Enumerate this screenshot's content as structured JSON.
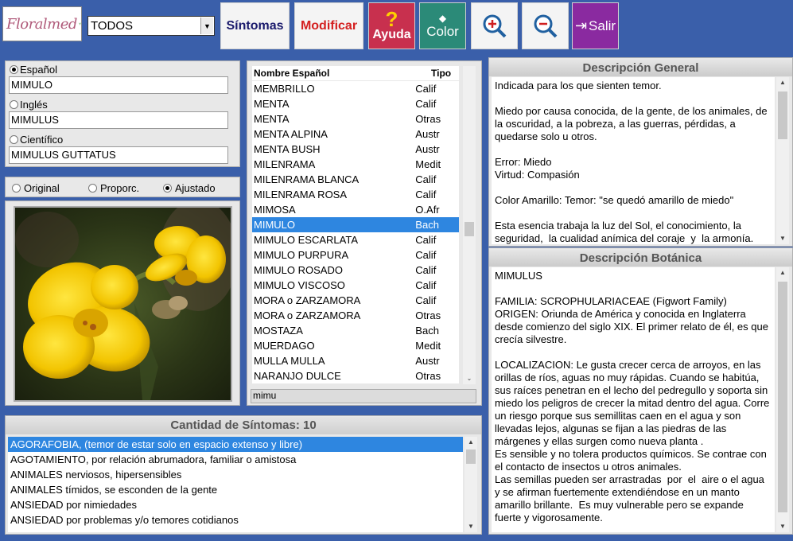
{
  "toolbar": {
    "logo_text": "Floralmed",
    "filter_value": "TODOS",
    "sintomas_label": "Síntomas",
    "modificar_label": "Modificar",
    "ayuda_label": "Ayuda",
    "color_label": "Color",
    "zoom_in_icon": "zoom-in-icon",
    "zoom_out_icon": "zoom-out-icon",
    "salir_label": "Salir"
  },
  "languages": {
    "espanol_label": "Español",
    "espanol_value": "MIMULO",
    "ingles_label": "Inglés",
    "ingles_value": "MIMULUS",
    "cientifico_label": "Científico",
    "cientifico_value": "MIMULUS GUTTATUS",
    "selected": "Español"
  },
  "image_mode": {
    "original_label": "Original",
    "proporc_label": "Proporc.",
    "ajustado_label": "Ajustado",
    "selected": "Ajustado"
  },
  "flower_list": {
    "col_name": "Nombre Español",
    "col_type": "Tipo",
    "rows": [
      {
        "name": "MEMBRILLO",
        "type": "Calif"
      },
      {
        "name": "MENTA",
        "type": "Calif"
      },
      {
        "name": "MENTA",
        "type": "Otras"
      },
      {
        "name": "MENTA ALPINA",
        "type": "Austr"
      },
      {
        "name": "MENTA BUSH",
        "type": "Austr"
      },
      {
        "name": "MILENRAMA",
        "type": "Medit"
      },
      {
        "name": "MILENRAMA BLANCA",
        "type": "Calif"
      },
      {
        "name": "MILENRAMA ROSA",
        "type": "Calif"
      },
      {
        "name": "MIMOSA",
        "type": "O.Afr"
      },
      {
        "name": "MIMULO",
        "type": "Bach"
      },
      {
        "name": "MIMULO ESCARLATA",
        "type": "Calif"
      },
      {
        "name": "MIMULO PURPURA",
        "type": "Calif"
      },
      {
        "name": "MIMULO ROSADO",
        "type": "Calif"
      },
      {
        "name": "MIMULO VISCOSO",
        "type": "Calif"
      },
      {
        "name": "MORA o ZARZAMORA",
        "type": "Calif"
      },
      {
        "name": "MORA o ZARZAMORA",
        "type": "Otras"
      },
      {
        "name": "MOSTAZA",
        "type": "Bach"
      },
      {
        "name": "MUERDAGO",
        "type": "Medit"
      },
      {
        "name": "MULLA MULLA",
        "type": "Austr"
      },
      {
        "name": "NARANJO DULCE",
        "type": "Otras"
      }
    ],
    "selected_index": 9,
    "search_text": "mimu"
  },
  "symptoms": {
    "title": "Cantidad de Síntomas: 10",
    "items": [
      "AGORAFOBIA, (temor de estar solo en espacio extenso y libre)",
      "AGOTAMIENTO, por relación abrumadora, familiar o amistosa",
      "ANIMALES nerviosos, hipersensibles",
      "ANIMALES tímidos, se esconden de la gente",
      "ANSIEDAD por nimiedades",
      "ANSIEDAD por problemas y/o temores cotidianos"
    ],
    "selected_index": 0
  },
  "descripcion_general": {
    "title": "Descripción General",
    "text": "Indicada para los que sienten temor.\n\nMiedo por causa conocida, de la gente, de los animales, de la oscuridad, a la pobreza, a las guerras, pérdidas, a quedarse solo u otros.\n\nError: Miedo\nVirtud: Compasión\n\nColor Amarillo: Temor: \"se quedó amarillo de miedo\"\n\nEsta esencia trabaja la luz del Sol, el conocimiento, la seguridad,  la cualidad anímica del coraje  y  la armonía."
  },
  "descripcion_botanica": {
    "title": "Descripción Botánica",
    "text": "MIMULUS\n\nFAMILIA: SCROPHULARIACEAE (Figwort Family)\nORIGEN: Oriunda de América y conocida en Inglaterra desde comienzo del siglo XIX. El primer relato de él, es que crecía silvestre.\n\nLOCALIZACION: Le gusta crecer cerca de arroyos, en las orillas de ríos, aguas no muy rápidas. Cuando se habitúa, sus raíces penetran en el lecho del pedregullo y soporta sin miedo los peligros de crecer la mitad dentro del agua. Corre un riesgo porque sus semillitas caen en el agua y son llevadas lejos, algunas se fijan a las piedras de las márgenes y ellas surgen como nueva planta .\nEs sensible y no tolera productos químicos. Se contrae con el contacto de insectos u otros animales.\nLas semillas pueden ser arrastradas  por  el  aire o el agua y se afirman fuertemente extendiéndose en un manto amarillo brillante.  Es muy vulnerable pero se expande fuerte y vigorosamente."
  }
}
